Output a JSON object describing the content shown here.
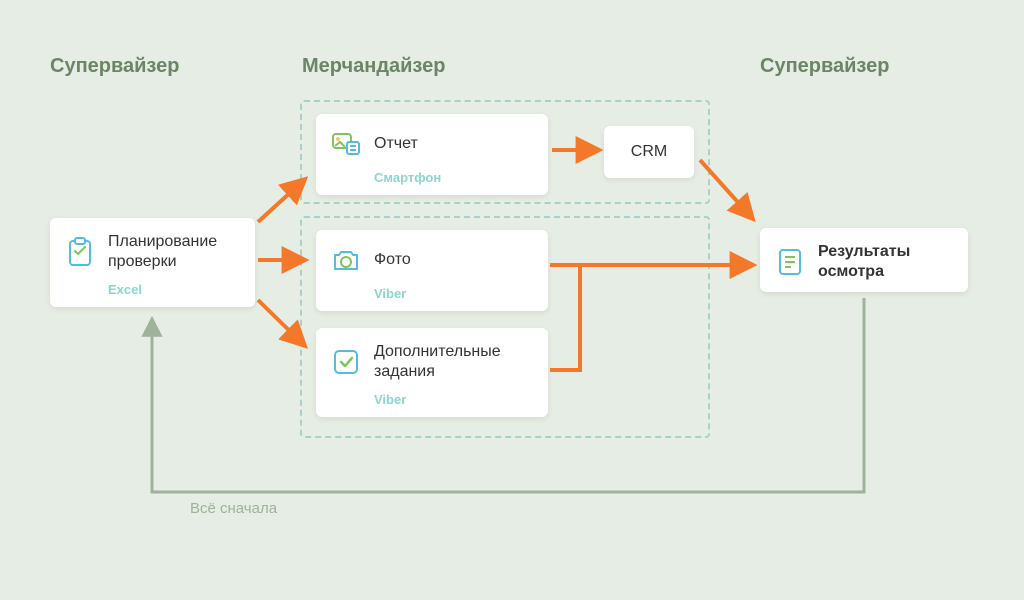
{
  "roles": {
    "left": "Супервайзер",
    "center": "Мерчандайзер",
    "right": "Супервайзер"
  },
  "cards": {
    "planning": {
      "title": "Планирование проверки",
      "sub": "Excel"
    },
    "report": {
      "title": "Отчет",
      "sub": "Смартфон"
    },
    "crm": {
      "title": "CRM"
    },
    "photo": {
      "title": "Фото",
      "sub": "Viber"
    },
    "tasks": {
      "title": "Дополнительные задания",
      "sub": "Viber"
    },
    "results": {
      "title": "Результаты осмотра"
    }
  },
  "loop_label": "Всё сначала",
  "colors": {
    "arrow_orange": "#f3782a",
    "arrow_green": "#9fb29b",
    "dashed_border": "#a7d1c9",
    "role_text": "#6b8566",
    "sub_text": "#8bd6ce"
  }
}
